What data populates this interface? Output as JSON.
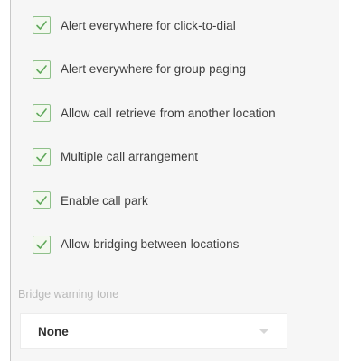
{
  "options": [
    {
      "label": "Alert everywhere for click-to-dial",
      "checked": true
    },
    {
      "label": "Alert everywhere for group paging",
      "checked": true
    },
    {
      "label": "Allow call retrieve from another location",
      "checked": true
    },
    {
      "label": "Multiple call arrangement",
      "checked": true
    },
    {
      "label": "Enable call park",
      "checked": true
    },
    {
      "label": "Allow bridging between locations",
      "checked": true
    }
  ],
  "bridge_warning": {
    "label": "Bridge warning tone",
    "selected": "None"
  },
  "colors": {
    "check_green": "#5fa85a",
    "checkbox_border": "#8fc08a"
  },
  "icons": {
    "check": "checkmark-icon",
    "dropdown": "chevron-down-icon"
  }
}
